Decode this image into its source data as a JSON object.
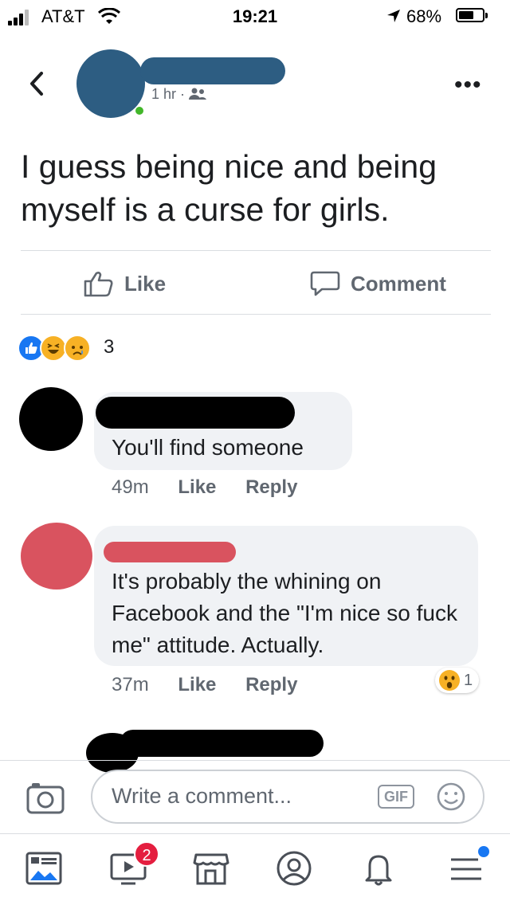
{
  "status_bar": {
    "carrier": "AT&T",
    "time": "19:21",
    "battery": "68%"
  },
  "post": {
    "meta_time": "1 hr ·",
    "text": "I guess being nice and being myself is a curse for girls.",
    "actions": {
      "like": "Like",
      "comment": "Comment"
    },
    "reaction_count": "3"
  },
  "comments": [
    {
      "text": "You'll find someone",
      "time": "49m",
      "like": "Like",
      "reply": "Reply"
    },
    {
      "text": "It's probably the whining on Facebook and the \"I'm nice so fuck me\" attitude. Actually.",
      "time": "37m",
      "like": "Like",
      "reply": "Reply",
      "reaction_count": "1"
    }
  ],
  "composer": {
    "placeholder": "Write a comment...",
    "gif": "GIF"
  },
  "tabbar": {
    "video_badge": "2"
  },
  "colors": {
    "accent": "#1877f2",
    "badge": "#e41e3f",
    "redaction": "#000000",
    "redaction_alt": "#d9535f",
    "avatar_blue": "#2d5d82"
  },
  "icons": [
    "back-icon",
    "more-icon",
    "like-icon",
    "comment-icon",
    "camera-icon",
    "gif-icon",
    "emoji-icon",
    "news-feed-icon",
    "watch-icon",
    "marketplace-icon",
    "profile-icon",
    "notifications-icon",
    "menu-icon"
  ]
}
